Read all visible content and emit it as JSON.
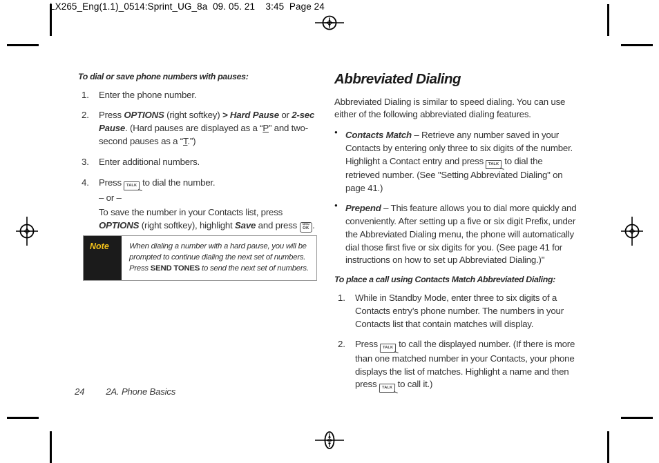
{
  "print_header": "LX265_Eng(1.1)_0514:Sprint_UG_8a  09. 05. 21    3:45  Page 24",
  "left_column": {
    "lead": "To dial or save phone numbers with pauses:",
    "steps": [
      {
        "id": "step-1",
        "parts": [
          {
            "type": "text",
            "value": "Enter the phone number."
          }
        ]
      },
      {
        "id": "step-2",
        "parts": [
          {
            "type": "text",
            "value": "Press "
          },
          {
            "type": "term",
            "value": "OPTIONS"
          },
          {
            "type": "text",
            "value": " (right softkey) "
          },
          {
            "type": "term",
            "value": "> Hard Pause"
          },
          {
            "type": "text",
            "value": " or "
          },
          {
            "type": "term",
            "value": "2-sec Pause"
          },
          {
            "type": "text",
            "value": ". (Hard pauses are displayed as a “"
          },
          {
            "type": "underline",
            "value": "P"
          },
          {
            "type": "text",
            "value": "” and two-second pauses as a “"
          },
          {
            "type": "underline",
            "value": "T"
          },
          {
            "type": "text",
            "value": ".”)"
          }
        ]
      },
      {
        "id": "step-3",
        "parts": [
          {
            "type": "text",
            "value": "Enter additional numbers."
          }
        ]
      },
      {
        "id": "step-4",
        "parts": [
          {
            "type": "text",
            "value": "Press "
          },
          {
            "type": "key",
            "value": "talk-key"
          },
          {
            "type": "text",
            "value": " to dial the number."
          }
        ],
        "alt_label": "– or –",
        "alt_parts": [
          {
            "type": "text",
            "value": "To save the number in your Contacts list, press "
          },
          {
            "type": "term",
            "value": "OPTIONS"
          },
          {
            "type": "text",
            "value": " (right softkey), highlight "
          },
          {
            "type": "term",
            "value": "Save"
          },
          {
            "type": "text",
            "value": " and press "
          },
          {
            "type": "key",
            "value": "menu-ok-key"
          },
          {
            "type": "text",
            "value": "."
          }
        ]
      }
    ],
    "note": {
      "label": "Note",
      "text_before": "When dialing a number with a hard pause, you will be prompted to continue dialing the next set of numbers. Press ",
      "bold": "SEND TONES",
      "text_after": " to send the next set of numbers."
    }
  },
  "right_column": {
    "title": "Abbreviated Dialing",
    "intro": "Abbreviated Dialing is similar to speed dialing. You can use either of the following abbreviated dialing features.",
    "bullets": [
      {
        "id": "bullet-contacts-match",
        "parts": [
          {
            "type": "term",
            "value": "Contacts Match"
          },
          {
            "type": "text",
            "value": " – Retrieve any number saved in your Contacts by entering only three to six digits of the number. Highlight a Contact entry and press "
          },
          {
            "type": "key",
            "value": "talk-key"
          },
          {
            "type": "text",
            "value": " to dial the retrieved number. (See \"Setting Abbreviated Dialing\" on page 41.)"
          }
        ]
      },
      {
        "id": "bullet-prepend",
        "parts": [
          {
            "type": "term",
            "value": "Prepend"
          },
          {
            "type": "text",
            "value": " – This feature allows you to dial more quickly and conveniently. After setting up a five or six digit Prefix, under the Abbreviated Dialing menu, the phone will automatically dial those first five or six digits for you. (See page 41 for instructions on how to set up Abbreviated Dialing.)\""
          }
        ]
      }
    ],
    "lead2": "To place a call using Contacts Match Abbreviated Dialing:",
    "steps": [
      {
        "id": "step-1",
        "parts": [
          {
            "type": "text",
            "value": "While in Standby Mode, enter three to six digits of a Contacts entry’s phone number. The numbers in your Contacts list that contain matches will display."
          }
        ]
      },
      {
        "id": "step-2",
        "parts": [
          {
            "type": "text",
            "value": "Press "
          },
          {
            "type": "key",
            "value": "talk-key"
          },
          {
            "type": "text",
            "value": " to call the displayed number. (If there is more than one matched number in your Contacts, your phone displays the list of matches. Highlight a name and then press "
          },
          {
            "type": "key",
            "value": "talk-key"
          },
          {
            "type": "text",
            "value": " to call it.)"
          }
        ]
      }
    ]
  },
  "footer": {
    "page_number": "24",
    "chapter": "2A. Phone Basics"
  },
  "keys": {
    "talk": "TALK",
    "menu": "MENU",
    "ok": "OK"
  },
  "colors": {
    "note_background": "#1b1b1b",
    "note_label": "#f4c21a",
    "text": "#333333",
    "paper": "#ffffff"
  }
}
